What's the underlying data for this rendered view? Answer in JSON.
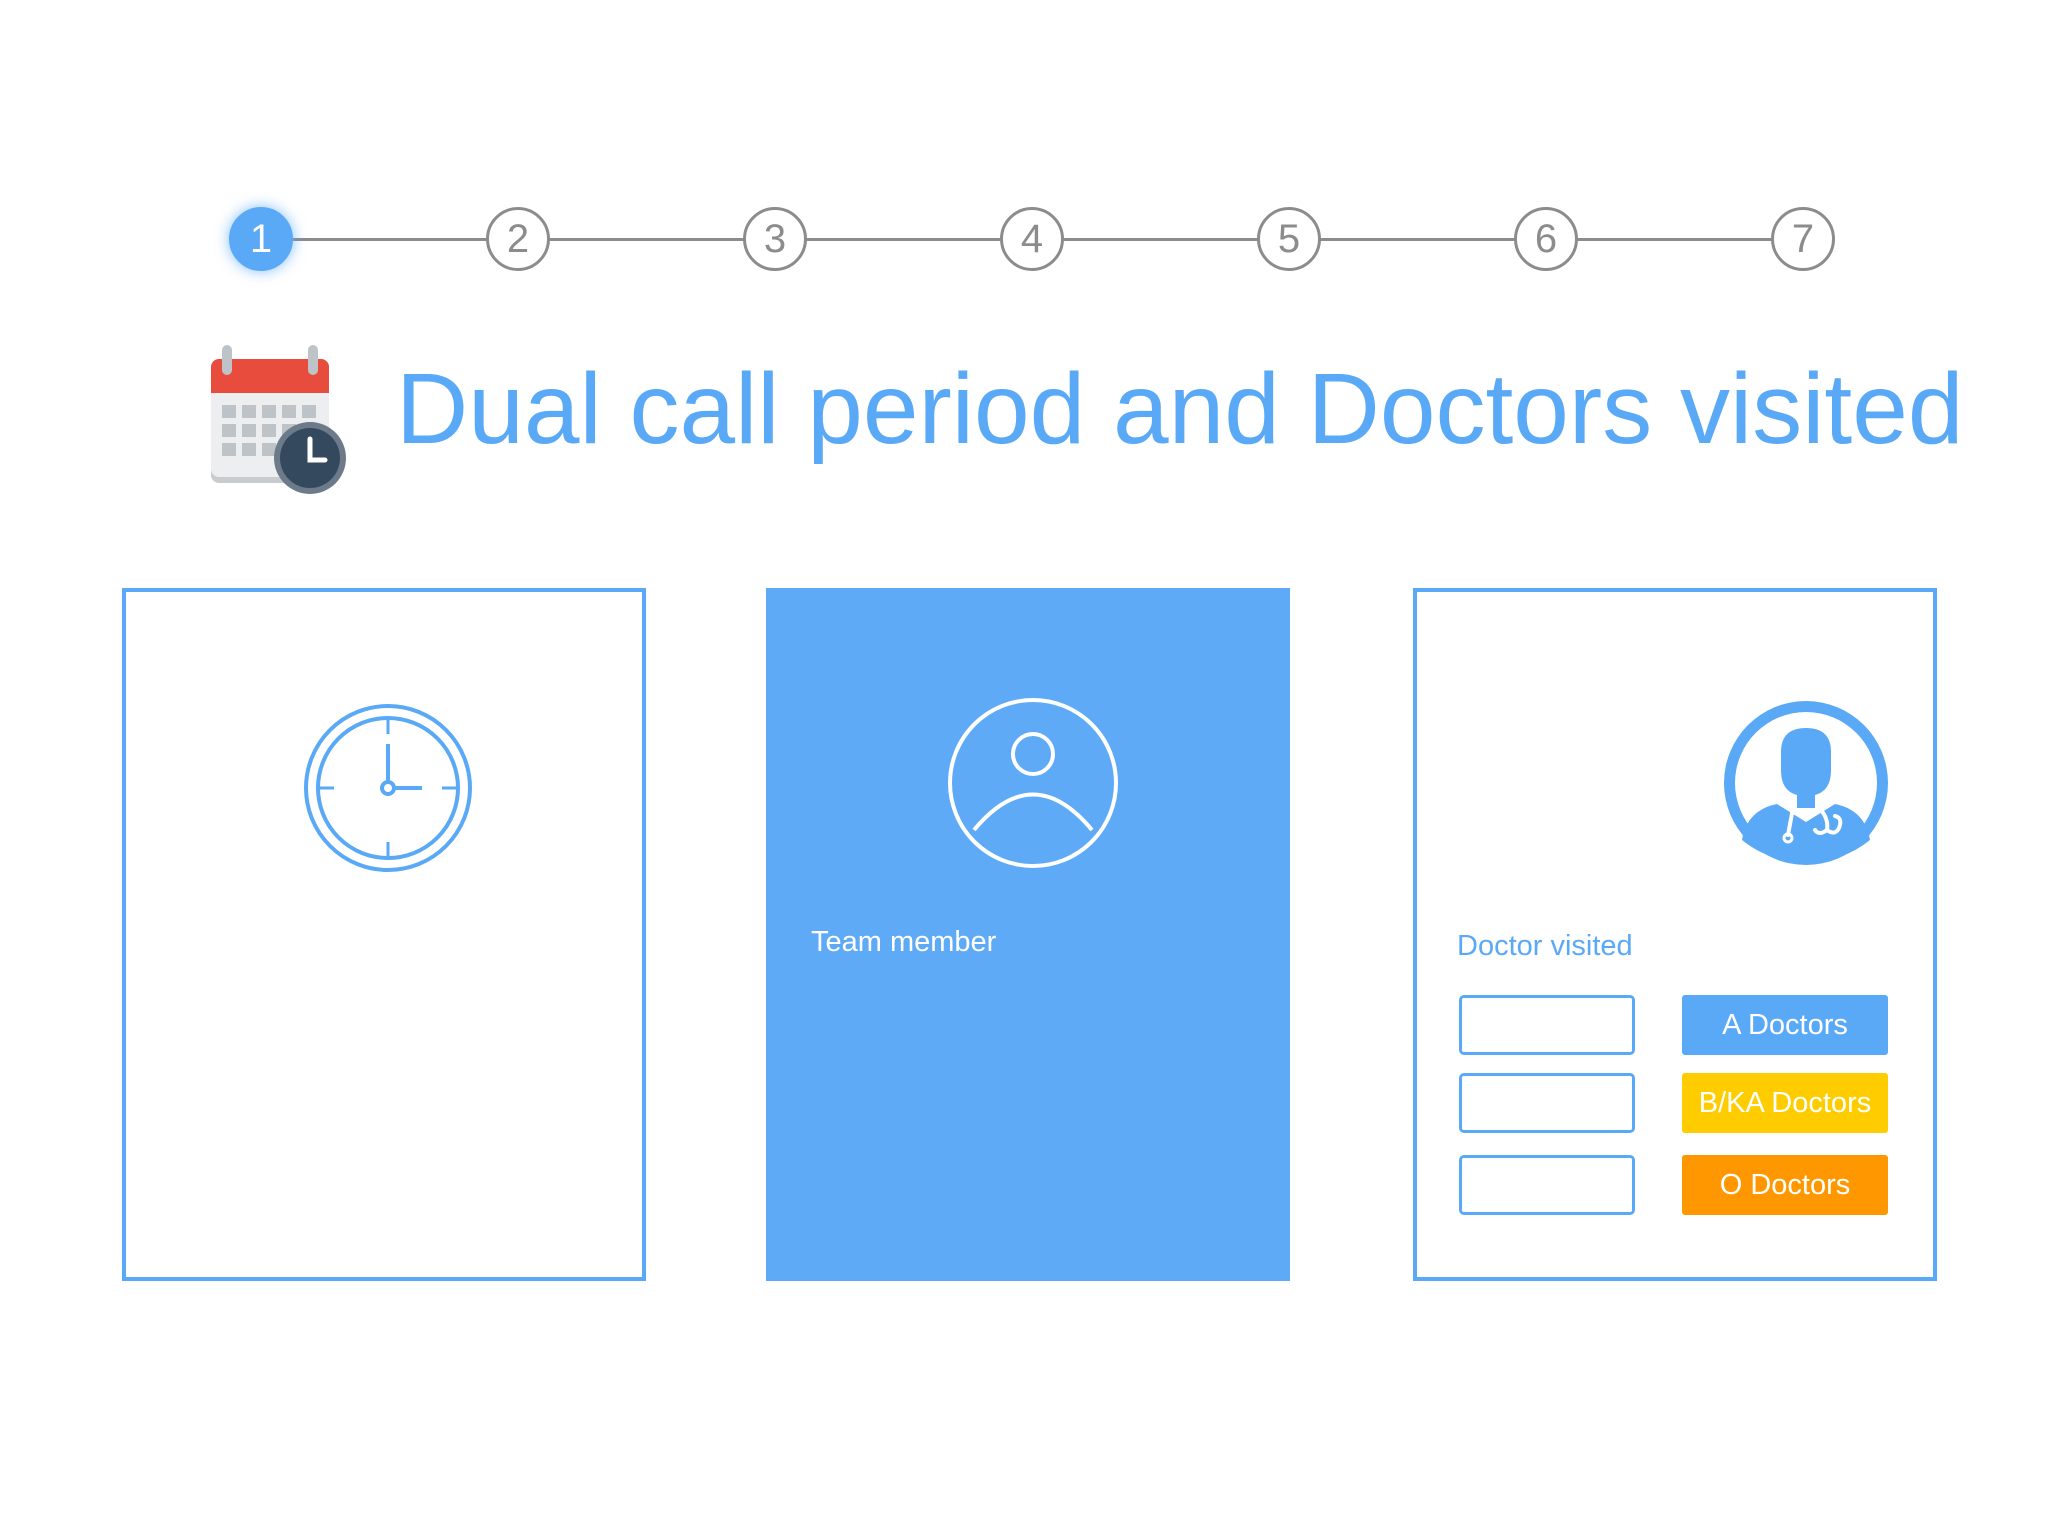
{
  "stepper": {
    "steps": [
      "1",
      "2",
      "3",
      "4",
      "5",
      "6",
      "7"
    ],
    "active_step": "1"
  },
  "header": {
    "title": "Dual call period and Doctors visited",
    "icon": "calendar-clock-icon"
  },
  "cards": {
    "period": {
      "icon": "clock-icon"
    },
    "team": {
      "icon": "user-icon",
      "label": "Team member"
    },
    "doctors": {
      "icon": "doctor-icon",
      "label": "Doctor visited",
      "categories": [
        {
          "label": "A Doctors",
          "value": "",
          "color": "#5aa9f7"
        },
        {
          "label": "B/KA Doctors",
          "value": "",
          "color": "#ffcc00"
        },
        {
          "label": "O Doctors",
          "value": "",
          "color": "#ff9800"
        }
      ]
    }
  },
  "colors": {
    "accent": "#5aa9f7",
    "step_inactive": "#8c8c8c",
    "team_card": "#5faaf7"
  }
}
